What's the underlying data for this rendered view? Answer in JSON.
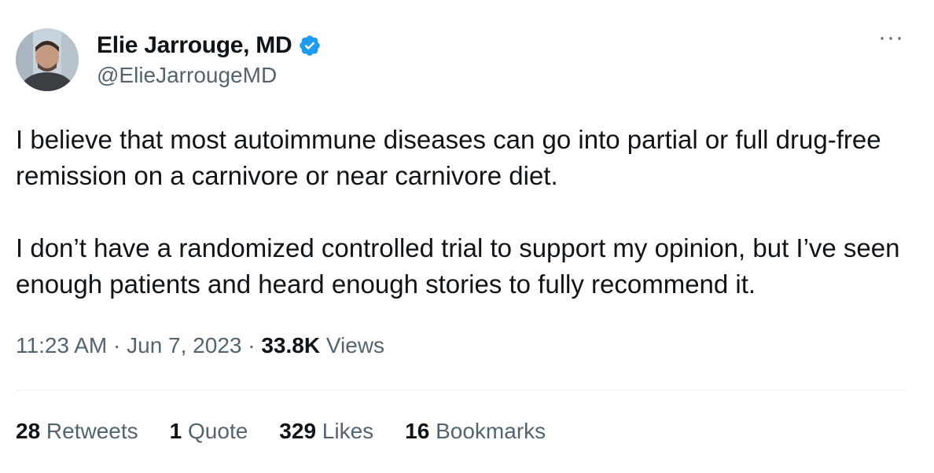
{
  "author": {
    "display_name": "Elie Jarrouge, MD",
    "handle": "@ElieJarrougeMD",
    "verified_icon": "verified-badge-icon",
    "verified_color": "#1d9bf0"
  },
  "menu": {
    "more_label": "···"
  },
  "tweet": {
    "paragraphs": [
      "I believe that most autoimmune diseases can go into partial or full drug-free remission on a carnivore or near carnivore diet.",
      "I don’t have a randomized controlled trial to support my opinion, but I’ve seen enough patients and heard enough stories to fully recommend it."
    ]
  },
  "meta": {
    "time": "11:23 AM",
    "sep1": " · ",
    "date": "Jun 7, 2023",
    "sep2": " · ",
    "views_count": "33.8K",
    "views_label": " Views"
  },
  "stats": {
    "retweets": {
      "count": "28",
      "label": " Retweets"
    },
    "quotes": {
      "count": "1",
      "label": " Quote"
    },
    "likes": {
      "count": "329",
      "label": " Likes"
    },
    "bookmarks": {
      "count": "16",
      "label": " Bookmarks"
    }
  },
  "colors": {
    "text_primary": "#0f1419",
    "text_secondary": "#536471",
    "divider": "#eff3f4"
  }
}
